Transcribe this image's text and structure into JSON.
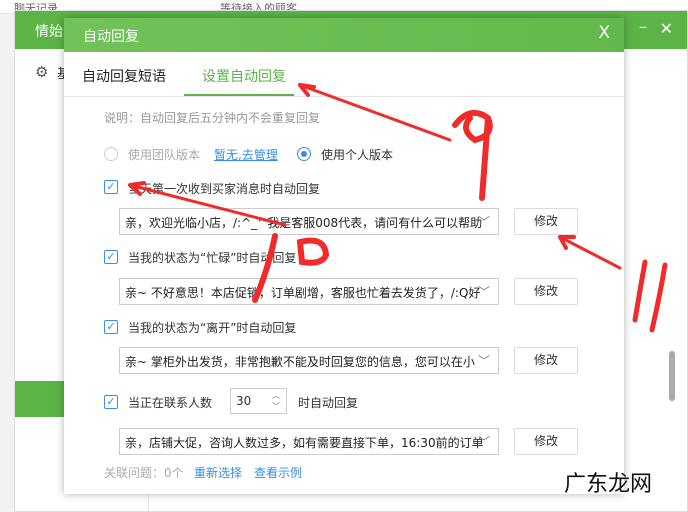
{
  "background": {
    "top_left": "聊天记录",
    "top_center": "等待接入的顾客",
    "window_title": "情始",
    "side_item": "基"
  },
  "dialog": {
    "title": "自动回复",
    "close": "X",
    "tabs": [
      "自动回复短语",
      "设置自动回复"
    ],
    "active_tab": 1,
    "note": "说明：自动回复后五分钟内不会重复回复",
    "radio_team": "使用团队版本",
    "team_link": "暂无,去管理",
    "radio_personal": "使用个人版本",
    "rules": [
      {
        "label": "当天第一次收到买家消息时自动回复",
        "checked": true,
        "reply": "亲，欢迎光临小店，/:^_^我是客服008代表，请问有什么可以帮助",
        "button": "修改"
      },
      {
        "label": "当我的状态为“忙碌”时自动回复",
        "checked": true,
        "reply": "亲~ 不好意思！本店促销，订单剧增，客服也忙着去发货了，/:Q好",
        "button": "修改"
      },
      {
        "label": "当我的状态为“离开”时自动回复",
        "checked": true,
        "reply": "亲~ 掌柜外出发货，非常抱歉不能及时回复您的信息，您可以在小",
        "button": "修改"
      },
      {
        "label": "当正在联系人数",
        "label_suffix": "时自动回复",
        "count": "30",
        "checked": true,
        "reply": "亲，店铺大促，咨询人数过多，如有需要直接下单，16:30前的订单",
        "button": "修改"
      }
    ],
    "related": "关联问题：0个",
    "reselect": "重新选择",
    "view_example": "查看示例"
  },
  "annotations": [
    "9",
    "10",
    "11"
  ],
  "watermark": "广东龙网"
}
